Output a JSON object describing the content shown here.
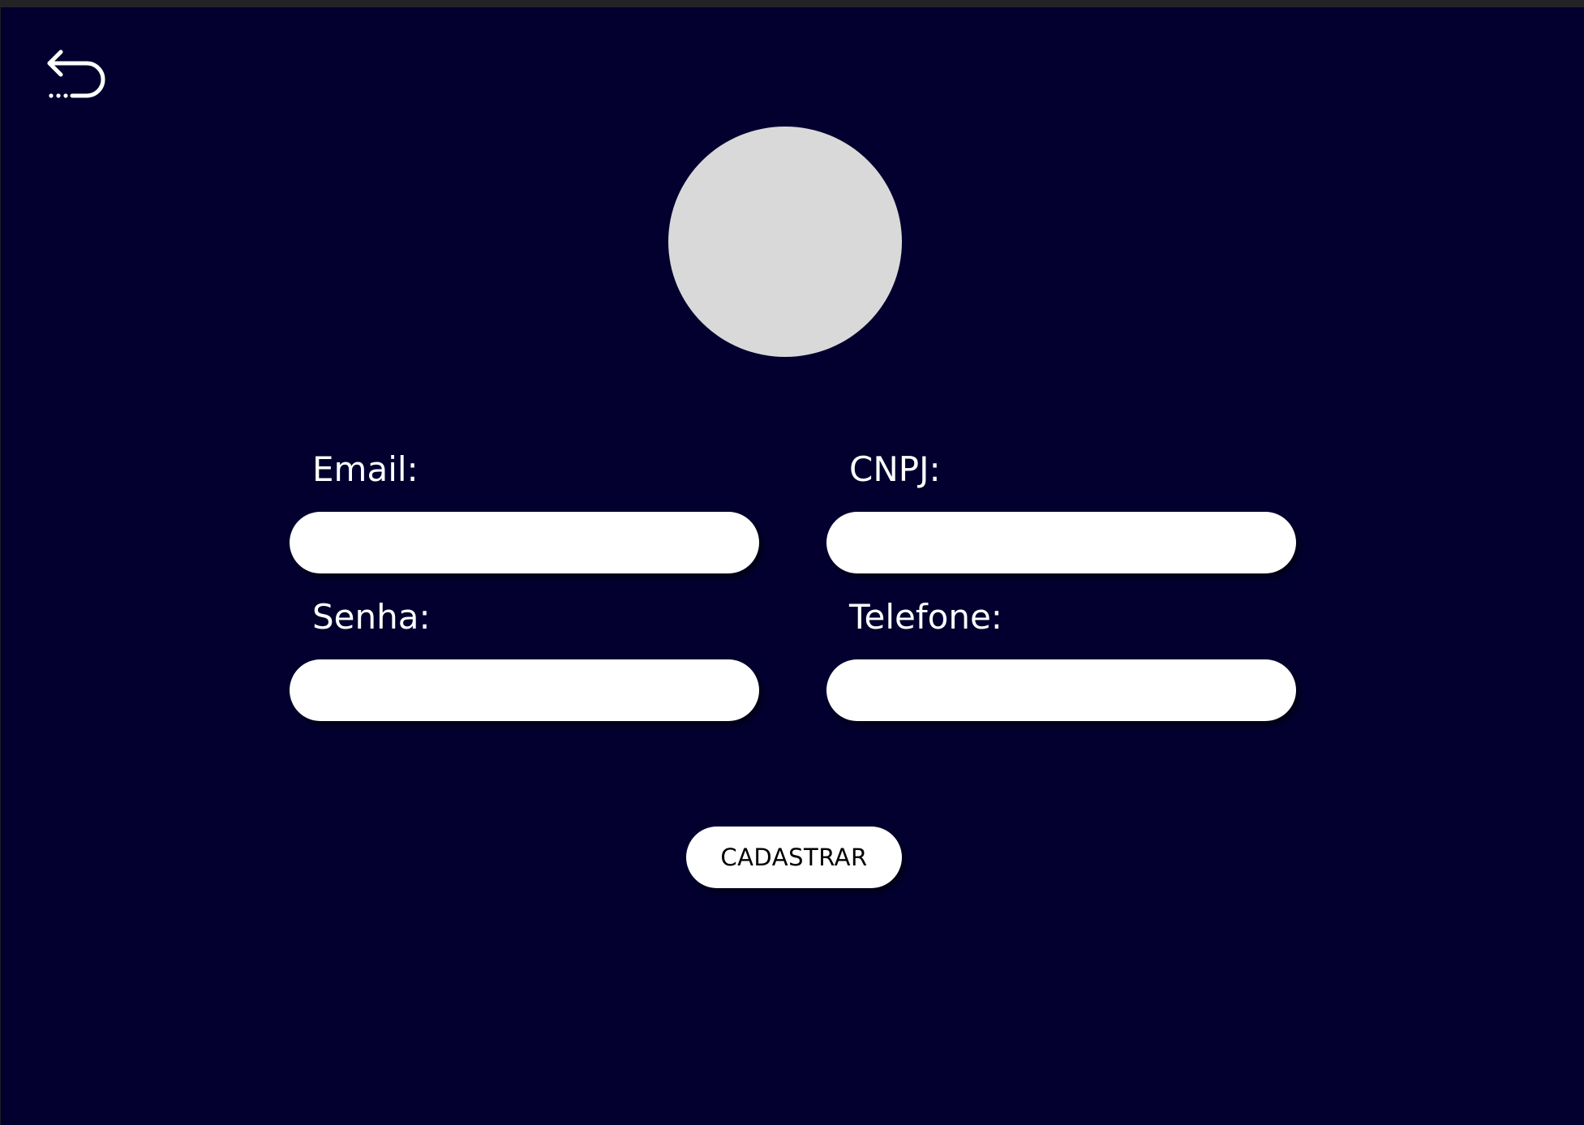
{
  "icons": {
    "back": "undo-arrow-icon"
  },
  "colors": {
    "background": "#03002f",
    "avatar": "#d9d9d9",
    "input": "#ffffff",
    "text": "#ffffff",
    "button_text": "#000000"
  },
  "form": {
    "email": {
      "label": "Email:",
      "value": "",
      "placeholder": ""
    },
    "cnpj": {
      "label": "CNPJ:",
      "value": "",
      "placeholder": ""
    },
    "senha": {
      "label": "Senha:",
      "value": "",
      "placeholder": ""
    },
    "telefone": {
      "label": "Telefone:",
      "value": "",
      "placeholder": ""
    }
  },
  "actions": {
    "submit_label": "CADASTRAR"
  }
}
